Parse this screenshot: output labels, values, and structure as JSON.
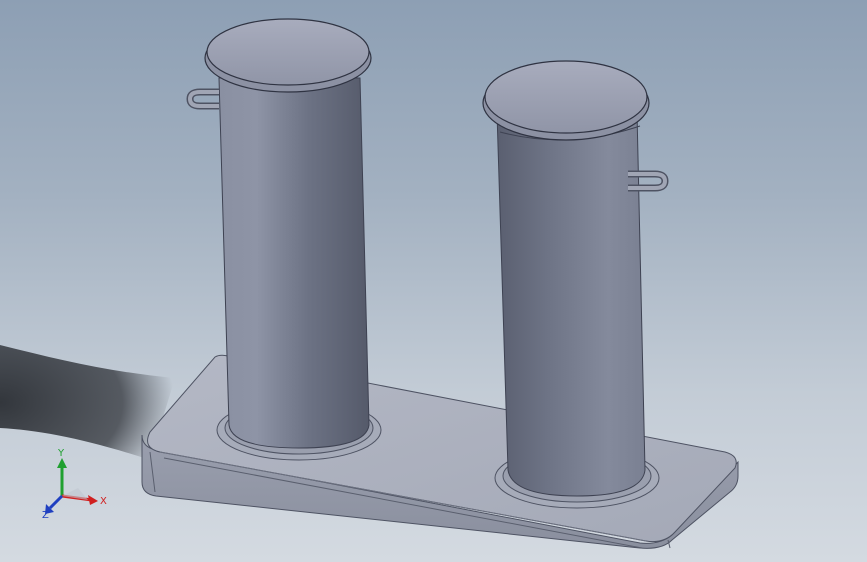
{
  "viewport": {
    "background_top": "#8d9fb4",
    "background_bottom": "#d4dae1"
  },
  "model": {
    "part_color": "#7c8395",
    "part_highlight": "#a6acbc",
    "part_shadow": "#4b5060",
    "cap_color": "#9ba0b2",
    "base_color": "#a8adbb"
  },
  "triad": {
    "x_label": "X",
    "y_label": "Y",
    "z_label": "Z",
    "x_color": "#d02020",
    "y_color": "#20a030",
    "z_color": "#2040c0"
  }
}
